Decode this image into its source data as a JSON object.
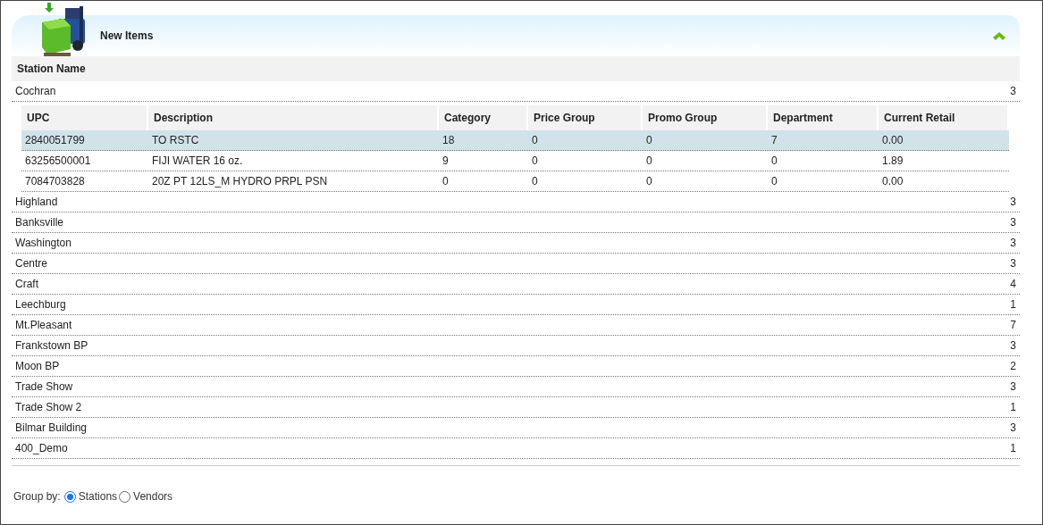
{
  "panel": {
    "title": "New Items"
  },
  "table": {
    "column": "Station Name"
  },
  "sub_columns": [
    "UPC",
    "Description",
    "Category",
    "Price Group",
    "Promo Group",
    "Department",
    "Current Retail"
  ],
  "stations": [
    {
      "name": "Cochran",
      "count": "3",
      "items": [
        {
          "cells": [
            "2840051799",
            "TO RSTC",
            "18",
            "0",
            "0",
            "7",
            "0.00"
          ],
          "selected": true
        },
        {
          "cells": [
            "63256500001",
            "FIJI WATER 16 oz.",
            "9",
            "0",
            "0",
            "0",
            "1.89"
          ],
          "selected": false
        },
        {
          "cells": [
            "7084703828",
            "20Z PT 12LS_M HYDRO PRPL PSN",
            "0",
            "0",
            "0",
            "0",
            "0.00"
          ],
          "selected": false
        }
      ]
    },
    {
      "name": "Highland",
      "count": "3"
    },
    {
      "name": "Banksville",
      "count": "3"
    },
    {
      "name": "Washington",
      "count": "3"
    },
    {
      "name": "Centre",
      "count": "3"
    },
    {
      "name": "Craft",
      "count": "4"
    },
    {
      "name": "Leechburg",
      "count": "1"
    },
    {
      "name": "Mt.Pleasant",
      "count": "7"
    },
    {
      "name": "Frankstown BP",
      "count": "3"
    },
    {
      "name": "Moon BP",
      "count": "2"
    },
    {
      "name": "Trade Show",
      "count": "3"
    },
    {
      "name": "Trade Show 2",
      "count": "1"
    },
    {
      "name": "Bilmar Building",
      "count": "3"
    },
    {
      "name": "400_Demo",
      "count": "1"
    }
  ],
  "group_by": {
    "label": "Group by:",
    "options": [
      {
        "label": "Stations",
        "selected": true
      },
      {
        "label": "Vendors",
        "selected": false
      }
    ]
  }
}
